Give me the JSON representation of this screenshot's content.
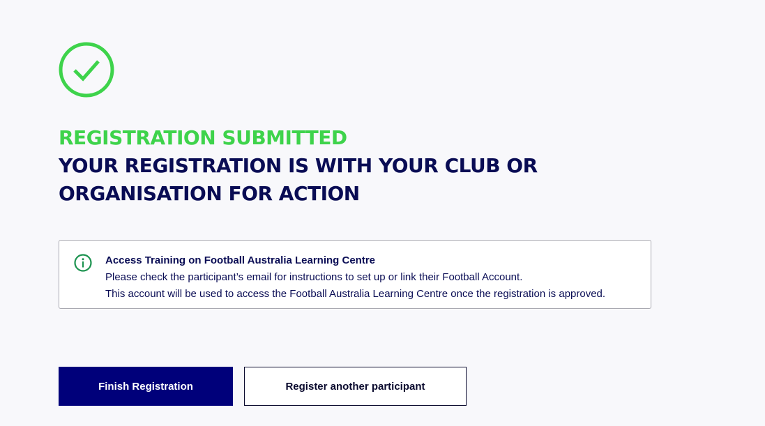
{
  "colors": {
    "accent_green": "#3ed34b",
    "navy": "#090c54",
    "primary_button": "#00007a",
    "info_green": "#1d9350"
  },
  "icons": {
    "success": "check-circle-icon",
    "info": "info-circle-icon"
  },
  "header": {
    "status": "REGISTRATION SUBMITTED",
    "title": "YOUR REGISTRATION IS WITH YOUR CLUB OR ORGANISATION FOR ACTION"
  },
  "info": {
    "title": "Access Training on Football Australia Learning Centre",
    "line1": "Please check the participant’s email for instructions to set up or link their Football Account.",
    "line2": "This account will be used to access the Football Australia Learning Centre once the registration is approved."
  },
  "actions": {
    "finish_label": "Finish Registration",
    "register_another_label": "Register another participant"
  }
}
